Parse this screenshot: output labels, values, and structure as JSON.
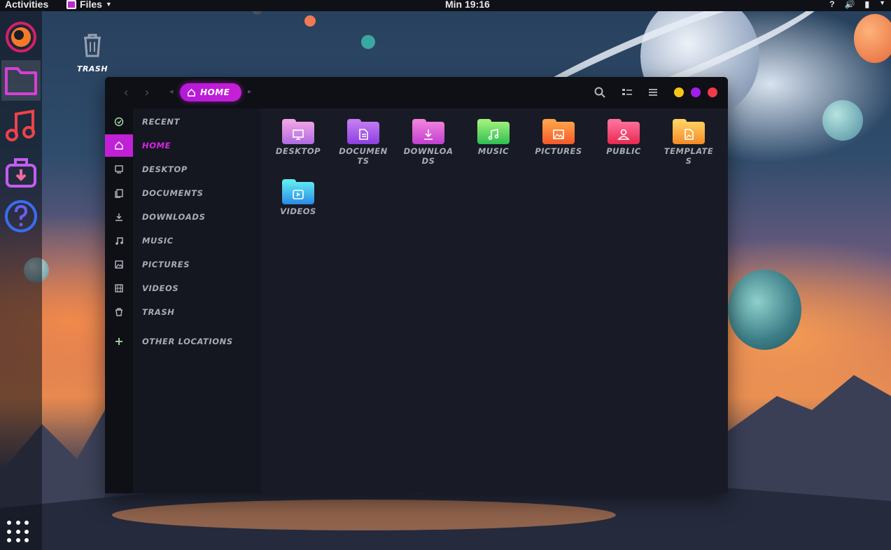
{
  "topbar": {
    "activities": "Activities",
    "app_name": "Files",
    "clock": "Min 19:16"
  },
  "desktop": {
    "trash_label": "TRASH"
  },
  "dock": {
    "items": [
      "firefox-icon",
      "files-icon",
      "music-icon",
      "software-icon",
      "help-icon"
    ],
    "apps_grid_icon": "show-apps-icon"
  },
  "window": {
    "pathbar": {
      "home_label": "HOME"
    },
    "controls": {
      "minimize_color": "#f5c518",
      "maximize_color": "#a31ee8",
      "close_color": "#f03a4a"
    },
    "sidebar": {
      "items": [
        {
          "label": "RECENT",
          "icon": "clock-icon"
        },
        {
          "label": "HOME",
          "icon": "home-icon",
          "active": true
        },
        {
          "label": "DESKTOP",
          "icon": "monitor-icon"
        },
        {
          "label": "DOCUMENTS",
          "icon": "document-icon"
        },
        {
          "label": "DOWNLOADS",
          "icon": "download-icon"
        },
        {
          "label": "MUSIC",
          "icon": "music-note-icon"
        },
        {
          "label": "PICTURES",
          "icon": "image-icon"
        },
        {
          "label": "VIDEOS",
          "icon": "film-icon"
        },
        {
          "label": "TRASH",
          "icon": "trash-icon"
        },
        {
          "label": "OTHER LOCATIONS",
          "icon": "plus-icon"
        }
      ]
    },
    "files": [
      {
        "name": "DESKTOP",
        "color_top": "#f0a3e6",
        "color_bottom": "#b06ae0"
      },
      {
        "name": "DOCUMENTS",
        "color_top": "#c27bf0",
        "color_bottom": "#8a3fe0"
      },
      {
        "name": "DOWNLOADS",
        "color_top": "#f07fdc",
        "color_bottom": "#c13fd0"
      },
      {
        "name": "MUSIC",
        "color_top": "#9cf07a",
        "color_bottom": "#2fbf52"
      },
      {
        "name": "PICTURES",
        "color_top": "#ffa24a",
        "color_bottom": "#f5592a"
      },
      {
        "name": "PUBLIC",
        "color_top": "#ff6f9b",
        "color_bottom": "#e8284f"
      },
      {
        "name": "TEMPLATES",
        "color_top": "#ffd060",
        "color_bottom": "#f58a28"
      },
      {
        "name": "VIDEOS",
        "color_top": "#5fe8f0",
        "color_bottom": "#2a8ae8"
      }
    ]
  }
}
